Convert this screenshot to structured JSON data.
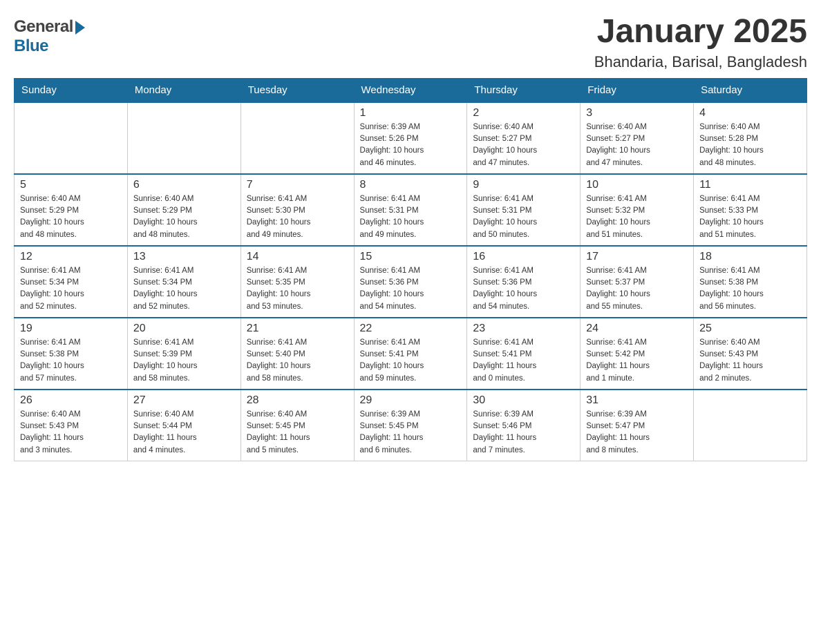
{
  "header": {
    "logo_general": "General",
    "logo_blue": "Blue",
    "month_title": "January 2025",
    "location": "Bhandaria, Barisal, Bangladesh"
  },
  "days_of_week": [
    "Sunday",
    "Monday",
    "Tuesday",
    "Wednesday",
    "Thursday",
    "Friday",
    "Saturday"
  ],
  "weeks": [
    {
      "days": [
        {
          "number": "",
          "info": ""
        },
        {
          "number": "",
          "info": ""
        },
        {
          "number": "",
          "info": ""
        },
        {
          "number": "1",
          "info": "Sunrise: 6:39 AM\nSunset: 5:26 PM\nDaylight: 10 hours\nand 46 minutes."
        },
        {
          "number": "2",
          "info": "Sunrise: 6:40 AM\nSunset: 5:27 PM\nDaylight: 10 hours\nand 47 minutes."
        },
        {
          "number": "3",
          "info": "Sunrise: 6:40 AM\nSunset: 5:27 PM\nDaylight: 10 hours\nand 47 minutes."
        },
        {
          "number": "4",
          "info": "Sunrise: 6:40 AM\nSunset: 5:28 PM\nDaylight: 10 hours\nand 48 minutes."
        }
      ]
    },
    {
      "days": [
        {
          "number": "5",
          "info": "Sunrise: 6:40 AM\nSunset: 5:29 PM\nDaylight: 10 hours\nand 48 minutes."
        },
        {
          "number": "6",
          "info": "Sunrise: 6:40 AM\nSunset: 5:29 PM\nDaylight: 10 hours\nand 48 minutes."
        },
        {
          "number": "7",
          "info": "Sunrise: 6:41 AM\nSunset: 5:30 PM\nDaylight: 10 hours\nand 49 minutes."
        },
        {
          "number": "8",
          "info": "Sunrise: 6:41 AM\nSunset: 5:31 PM\nDaylight: 10 hours\nand 49 minutes."
        },
        {
          "number": "9",
          "info": "Sunrise: 6:41 AM\nSunset: 5:31 PM\nDaylight: 10 hours\nand 50 minutes."
        },
        {
          "number": "10",
          "info": "Sunrise: 6:41 AM\nSunset: 5:32 PM\nDaylight: 10 hours\nand 51 minutes."
        },
        {
          "number": "11",
          "info": "Sunrise: 6:41 AM\nSunset: 5:33 PM\nDaylight: 10 hours\nand 51 minutes."
        }
      ]
    },
    {
      "days": [
        {
          "number": "12",
          "info": "Sunrise: 6:41 AM\nSunset: 5:34 PM\nDaylight: 10 hours\nand 52 minutes."
        },
        {
          "number": "13",
          "info": "Sunrise: 6:41 AM\nSunset: 5:34 PM\nDaylight: 10 hours\nand 52 minutes."
        },
        {
          "number": "14",
          "info": "Sunrise: 6:41 AM\nSunset: 5:35 PM\nDaylight: 10 hours\nand 53 minutes."
        },
        {
          "number": "15",
          "info": "Sunrise: 6:41 AM\nSunset: 5:36 PM\nDaylight: 10 hours\nand 54 minutes."
        },
        {
          "number": "16",
          "info": "Sunrise: 6:41 AM\nSunset: 5:36 PM\nDaylight: 10 hours\nand 54 minutes."
        },
        {
          "number": "17",
          "info": "Sunrise: 6:41 AM\nSunset: 5:37 PM\nDaylight: 10 hours\nand 55 minutes."
        },
        {
          "number": "18",
          "info": "Sunrise: 6:41 AM\nSunset: 5:38 PM\nDaylight: 10 hours\nand 56 minutes."
        }
      ]
    },
    {
      "days": [
        {
          "number": "19",
          "info": "Sunrise: 6:41 AM\nSunset: 5:38 PM\nDaylight: 10 hours\nand 57 minutes."
        },
        {
          "number": "20",
          "info": "Sunrise: 6:41 AM\nSunset: 5:39 PM\nDaylight: 10 hours\nand 58 minutes."
        },
        {
          "number": "21",
          "info": "Sunrise: 6:41 AM\nSunset: 5:40 PM\nDaylight: 10 hours\nand 58 minutes."
        },
        {
          "number": "22",
          "info": "Sunrise: 6:41 AM\nSunset: 5:41 PM\nDaylight: 10 hours\nand 59 minutes."
        },
        {
          "number": "23",
          "info": "Sunrise: 6:41 AM\nSunset: 5:41 PM\nDaylight: 11 hours\nand 0 minutes."
        },
        {
          "number": "24",
          "info": "Sunrise: 6:41 AM\nSunset: 5:42 PM\nDaylight: 11 hours\nand 1 minute."
        },
        {
          "number": "25",
          "info": "Sunrise: 6:40 AM\nSunset: 5:43 PM\nDaylight: 11 hours\nand 2 minutes."
        }
      ]
    },
    {
      "days": [
        {
          "number": "26",
          "info": "Sunrise: 6:40 AM\nSunset: 5:43 PM\nDaylight: 11 hours\nand 3 minutes."
        },
        {
          "number": "27",
          "info": "Sunrise: 6:40 AM\nSunset: 5:44 PM\nDaylight: 11 hours\nand 4 minutes."
        },
        {
          "number": "28",
          "info": "Sunrise: 6:40 AM\nSunset: 5:45 PM\nDaylight: 11 hours\nand 5 minutes."
        },
        {
          "number": "29",
          "info": "Sunrise: 6:39 AM\nSunset: 5:45 PM\nDaylight: 11 hours\nand 6 minutes."
        },
        {
          "number": "30",
          "info": "Sunrise: 6:39 AM\nSunset: 5:46 PM\nDaylight: 11 hours\nand 7 minutes."
        },
        {
          "number": "31",
          "info": "Sunrise: 6:39 AM\nSunset: 5:47 PM\nDaylight: 11 hours\nand 8 minutes."
        },
        {
          "number": "",
          "info": ""
        }
      ]
    }
  ]
}
